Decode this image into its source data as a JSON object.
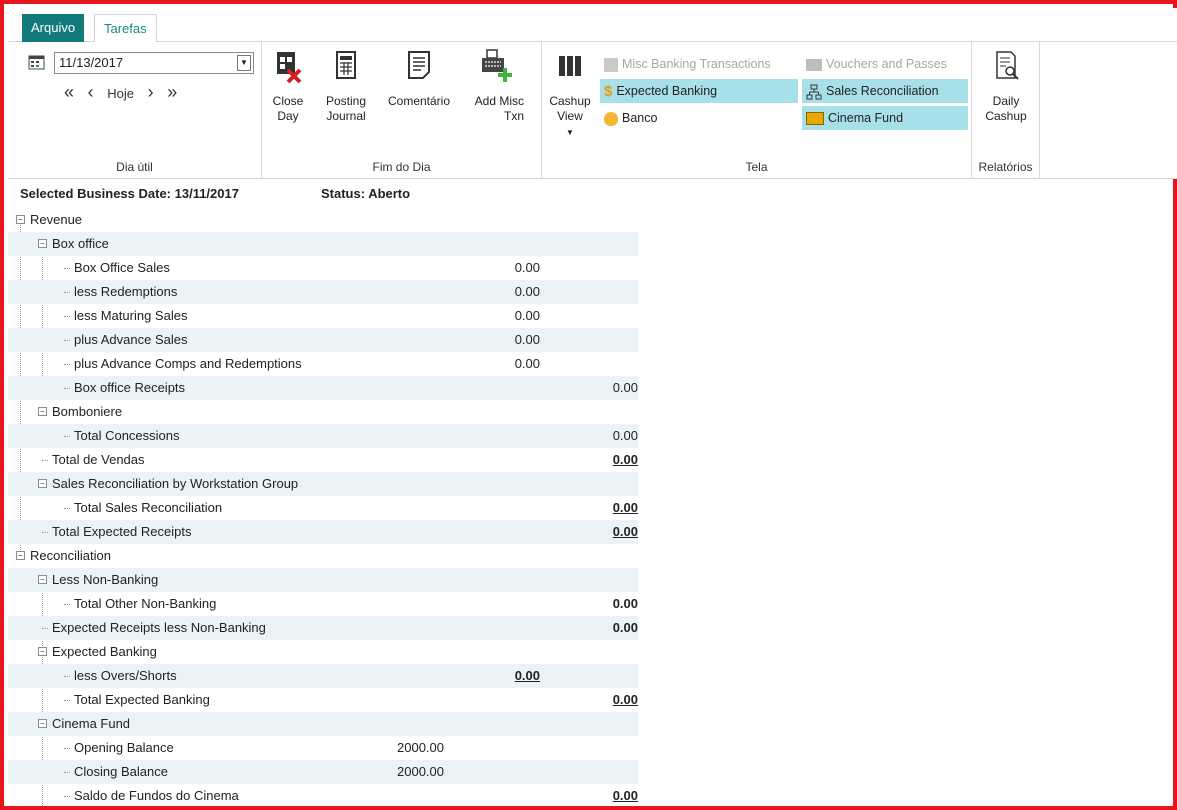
{
  "tabs": {
    "file": "Arquivo",
    "tasks": "Tarefas"
  },
  "ribbon": {
    "date_value": "11/13/2017",
    "nav": {
      "first": "«",
      "prev": "‹",
      "today": "Hoje",
      "next": "›",
      "last": "»"
    },
    "groups": {
      "business_day": "Dia útil",
      "end_of_day": "Fim do Dia",
      "view": "Tela",
      "reports": "Relatórios"
    },
    "buttons": {
      "close_day": "Close Day",
      "posting_journal": "Posting Journal",
      "comment": "Comentário",
      "add_misc_txn": "Add Misc Txn",
      "cashup_view": "Cashup View",
      "daily_cashup": "Daily Cashup"
    },
    "views": {
      "misc_banking": "Misc Banking Transactions",
      "vouchers": "Vouchers and Passes",
      "expected_banking": "Expected Banking",
      "sales_reconciliation": "Sales Reconciliation",
      "banco": "Banco",
      "cinema_fund": "Cinema Fund"
    }
  },
  "header": {
    "business_date": "Selected Business Date: 13/11/2017",
    "status": "Status: Aberto"
  },
  "tree": {
    "revenue": "Revenue",
    "box_office": "Box office",
    "box_office_sales": {
      "label": "Box Office Sales",
      "value": "0.00"
    },
    "less_redemptions": {
      "label": "less Redemptions",
      "value": "0.00"
    },
    "less_maturing": {
      "label": "less Maturing Sales",
      "value": "0.00"
    },
    "plus_advance_sales": {
      "label": "plus Advance Sales",
      "value": "0.00"
    },
    "plus_advance_comps": {
      "label": "plus Advance Comps and Redemptions",
      "value": "0.00"
    },
    "box_office_receipts": {
      "label": "Box office Receipts",
      "value": "0.00"
    },
    "bomboniere": "Bomboniere",
    "total_concessions": {
      "label": "Total Concessions",
      "value": "0.00"
    },
    "total_vendas": {
      "label": "Total de Vendas",
      "value": "0.00"
    },
    "sales_recon_group": "Sales Reconciliation by Workstation Group",
    "total_sales_recon": {
      "label": "Total Sales Reconciliation",
      "value": "0.00"
    },
    "total_expected_receipts": {
      "label": "Total Expected Receipts",
      "value": "0.00"
    },
    "reconciliation": "Reconciliation",
    "less_non_banking": "Less Non-Banking",
    "total_other_non_banking": {
      "label": "Total Other Non-Banking",
      "value": "0.00"
    },
    "expected_receipts_less": {
      "label": "Expected Receipts less Non-Banking",
      "value": "0.00"
    },
    "expected_banking": "Expected Banking",
    "less_overs_shorts": {
      "label": "less Overs/Shorts",
      "value": "0.00"
    },
    "total_expected_banking": {
      "label": "Total Expected Banking",
      "value": "0.00"
    },
    "cinema_fund": "Cinema Fund",
    "opening_balance": {
      "label": "Opening Balance",
      "value": "2000.00"
    },
    "closing_balance": {
      "label": "Closing Balance",
      "value": "2000.00"
    },
    "saldo_fundos": {
      "label": "Saldo de Fundos do Cinema",
      "value": "0.00"
    }
  }
}
